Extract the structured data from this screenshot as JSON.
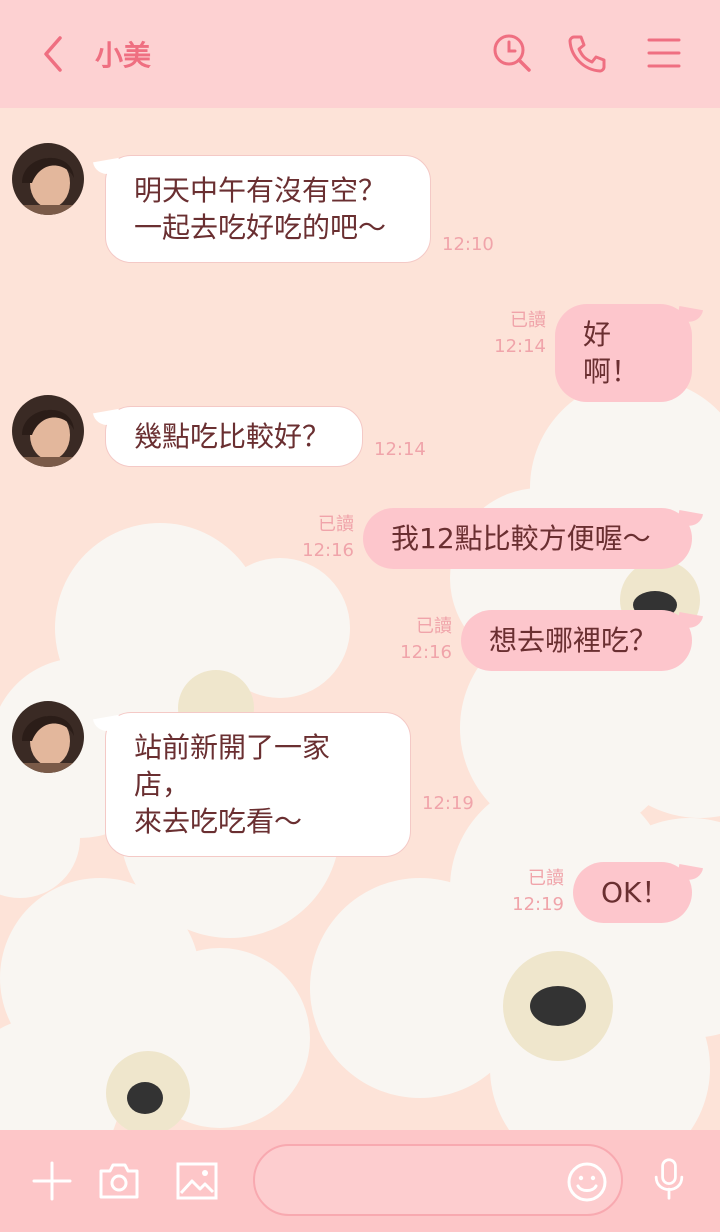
{
  "header": {
    "back_icon": "chevron-left-icon",
    "title": "小美",
    "icons": [
      "search-clock-icon",
      "phone-icon",
      "menu-icon"
    ],
    "color": "#ef6f81",
    "bg": "#fdd1d2"
  },
  "messages": [
    {
      "side": "in",
      "lines": [
        "明天中午有沒有空？",
        "一起去吃好吃的吧～"
      ],
      "time": "12:10"
    },
    {
      "side": "out",
      "text": "好啊！",
      "read": "已讀",
      "time": "12:14"
    },
    {
      "side": "in",
      "lines": [
        "幾點吃比較好？"
      ],
      "time": "12:14"
    },
    {
      "side": "out",
      "text": "我12點比較方便喔～",
      "read": "已讀",
      "time": "12:16"
    },
    {
      "side": "out",
      "text": "想去哪裡吃？",
      "read": "已讀",
      "time": "12:16"
    },
    {
      "side": "in",
      "lines": [
        "站前新開了一家店，",
        "來去吃吃看～"
      ],
      "time": "12:19"
    },
    {
      "side": "out",
      "text": "OK！",
      "read": "已讀",
      "time": "12:19"
    }
  ],
  "footer": {
    "icons": [
      "plus-icon",
      "camera-icon",
      "image-icon",
      "smiley-icon",
      "microphone-icon"
    ],
    "input_placeholder": ""
  },
  "colors": {
    "chat_bg": "#fde3d8",
    "bubble_out": "#fdc6cc",
    "bubble_in": "#ffffff",
    "text": "#6a2f31",
    "meta": "#f0a4aa"
  }
}
